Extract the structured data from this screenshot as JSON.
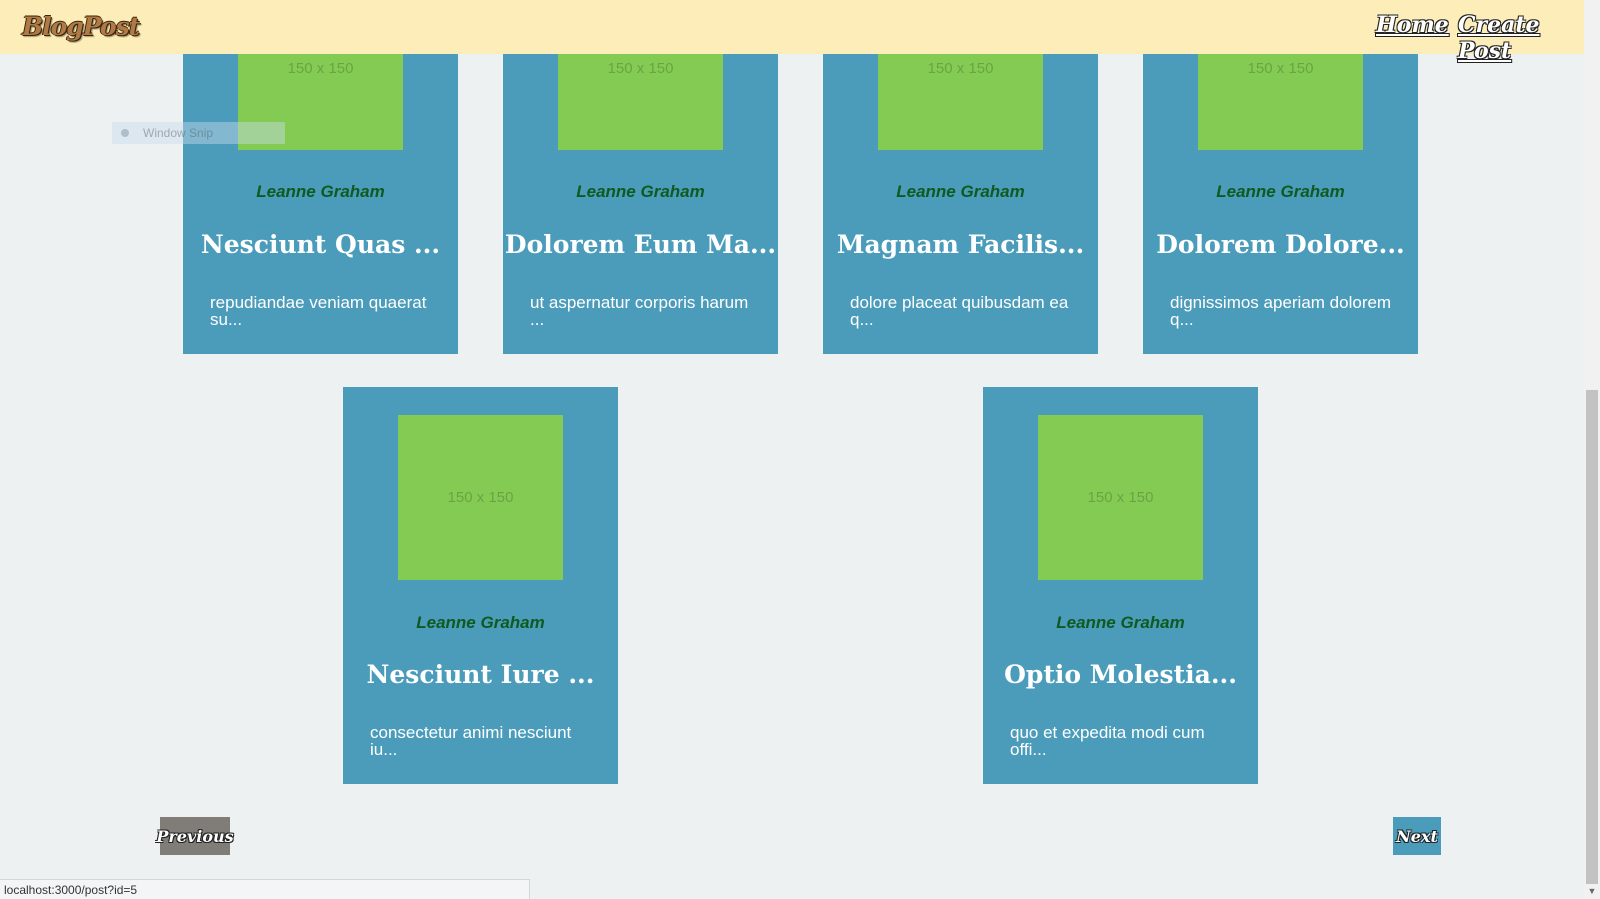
{
  "header": {
    "brand": "BlogPost",
    "nav": {
      "home": "Home",
      "create": "Create Post"
    }
  },
  "overlay": {
    "snip_label": "Window Snip"
  },
  "posts": [
    {
      "image_label": "150 x 150",
      "author": "Leanne Graham",
      "title": "Nesciunt Quas ...",
      "excerpt": "repudiandae veniam quaerat su..."
    },
    {
      "image_label": "150 x 150",
      "author": "Leanne Graham",
      "title": "Dolorem Eum Ma...",
      "excerpt": "ut aspernatur corporis harum ..."
    },
    {
      "image_label": "150 x 150",
      "author": "Leanne Graham",
      "title": "Magnam Facilis...",
      "excerpt": "dolore placeat quibusdam ea q..."
    },
    {
      "image_label": "150 x 150",
      "author": "Leanne Graham",
      "title": "Dolorem Dolore...",
      "excerpt": "dignissimos aperiam dolorem q..."
    },
    {
      "image_label": "150 x 150",
      "author": "Leanne Graham",
      "title": "Nesciunt Iure ...",
      "excerpt": "consectetur animi nesciunt iu..."
    },
    {
      "image_label": "150 x 150",
      "author": "Leanne Graham",
      "title": "Optio Molestia...",
      "excerpt": "quo et expedita modi cum offi..."
    }
  ],
  "pager": {
    "previous": "Previous",
    "next": "Next"
  },
  "status_bar": {
    "url": "localhost:3000/post?id=5"
  }
}
